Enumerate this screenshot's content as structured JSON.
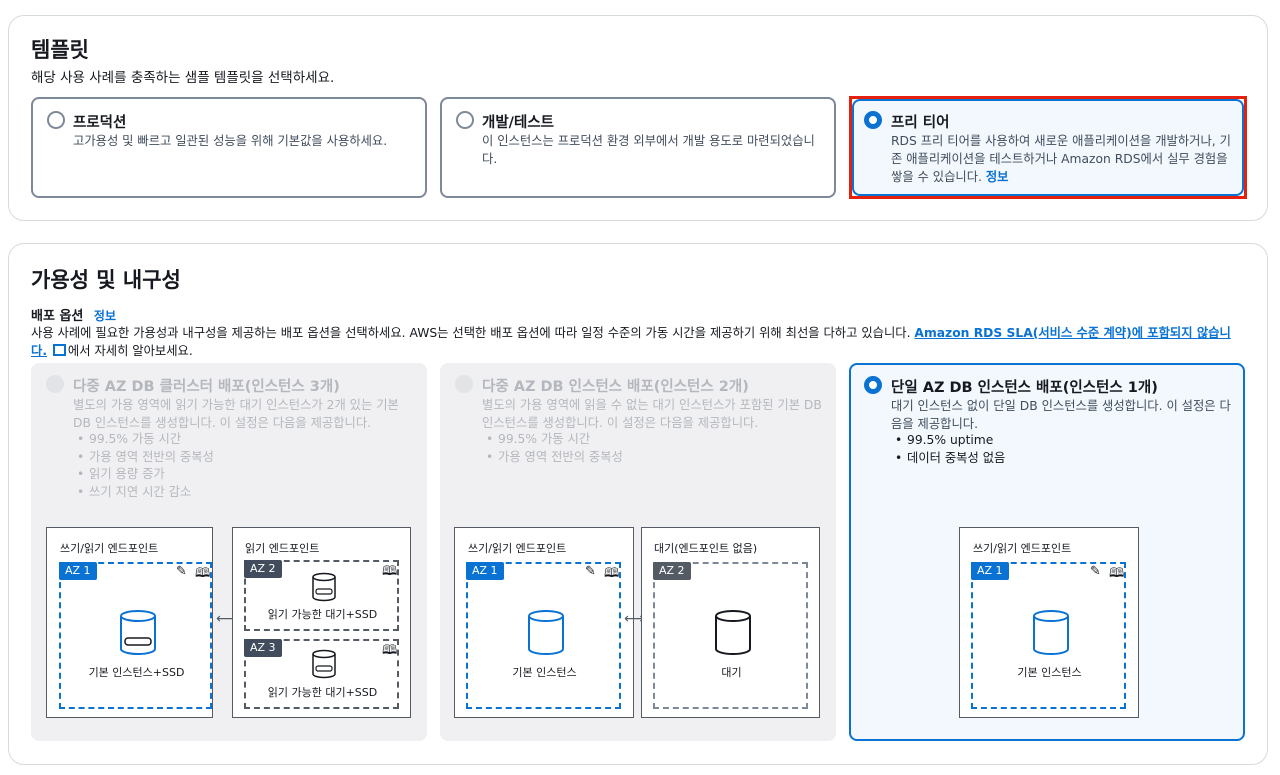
{
  "template": {
    "heading": "템플릿",
    "description": "해당 사용 사례를 충족하는 샘플 템플릿을 선택하세요.",
    "options": [
      {
        "title": "프로덕션",
        "desc": "고가용성 및 빠르고 일관된 성능을 위해 기본값을 사용하세요."
      },
      {
        "title": "개발/테스트",
        "desc": "이 인스턴스는 프로덕션 환경 외부에서 개발 용도로 마련되었습니다."
      },
      {
        "title": "프리 티어",
        "desc": "RDS 프리 티어를 사용하여 새로운 애플리케이션을 개발하거나, 기존 애플리케이션을 테스트하거나 Amazon RDS에서 실무 경험을 쌓을 수 있습니다.",
        "info": "정보"
      }
    ]
  },
  "availability": {
    "heading": "가용성 및 내구성",
    "deploy_label": "배포 옵션",
    "info": "정보",
    "desc_a": "사용 사례에 필요한 가용성과 내구성을 제공하는 배포 옵션을 선택하세요. AWS는 선택한 배포 옵션에 따라 일정 수준의 가동 시간을 제공하기 위해 최선을 다하고 있습니다.",
    "sla_link": "Amazon RDS SLA(서비스 수준 계약)에 포함되지 않습니다.",
    "desc_b": "에서 자세히 알아보세요.",
    "options": [
      {
        "title": "다중 AZ DB 클러스터 배포(인스턴스 3개)",
        "desc": "별도의 가용 영역에 읽기 가능한 대기 인스턴스가 2개 있는 기본 DB 인스턴스를 생성합니다. 이 설정은 다음을 제공합니다.",
        "bullets": [
          "99.5% 가동 시간",
          "가용 영역 전반의 중복성",
          "읽기 용량 증가",
          "쓰기 지연 시간 감소"
        ]
      },
      {
        "title": "다중 AZ DB 인스턴스 배포(인스턴스 2개)",
        "desc": "별도의 가용 영역에 읽을 수 없는 대기 인스턴스가 포함된 기본 DB 인스턴스를 생성합니다. 이 설정은 다음을 제공합니다.",
        "bullets": [
          "99.5% 가동 시간",
          "가용 영역 전반의 중복성"
        ]
      },
      {
        "title": "단일 AZ DB 인스턴스 배포(인스턴스 1개)",
        "desc": "대기 인스턴스 없이 단일 DB 인스턴스를 생성합니다. 이 설정은 다음을 제공합니다.",
        "bullets": [
          "99.5% uptime",
          "데이터 중복성 없음"
        ]
      }
    ],
    "diagram": {
      "rw_endpoint": "쓰기/읽기 엔드포인트",
      "read_endpoint": "읽기 엔드포인트",
      "standby_no_endpoint": "대기(엔드포인트 없음)",
      "az1": "AZ 1",
      "az2": "AZ 2",
      "az3": "AZ 3",
      "primary_ssd": "기본 인스턴스+SSD",
      "readable_standby_ssd": "읽기 가능한 대기+SSD",
      "primary": "기본 인스턴스",
      "standby": "대기"
    }
  }
}
